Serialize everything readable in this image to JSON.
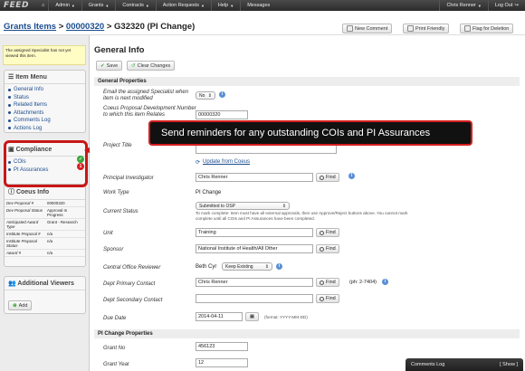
{
  "topnav": {
    "logo": "FEED",
    "items": [
      {
        "label": "Admin"
      },
      {
        "label": "Grants"
      },
      {
        "label": "Contracts"
      },
      {
        "label": "Action Requests"
      },
      {
        "label": "Help"
      },
      {
        "label": "Messages"
      }
    ],
    "user": "Chris Renner",
    "logout": "Log Out"
  },
  "breadcrumb": {
    "root": "Grants Items",
    "sep1": ">",
    "item": "00000320",
    "sep2": ">",
    "current": "G32320 (PI Change)"
  },
  "header_buttons": {
    "new_comment": "New Comment",
    "print_friendly": "Print Friendly",
    "flag_deletion": "Flag for Deletion"
  },
  "notice": "The assigned Specialist has not yet viewed this item.",
  "item_menu": {
    "title": "Item Menu",
    "items": [
      "General Info",
      "Status",
      "Related Items",
      "Attachments",
      "Comments Log",
      "Actions Log"
    ]
  },
  "compliance": {
    "title": "Compliance",
    "items": [
      {
        "label": "COIs",
        "badge": "✓",
        "badge_color": "#3aa53a"
      },
      {
        "label": "PI Assurances",
        "badge": "1",
        "badge_color": "#d61f1f"
      }
    ]
  },
  "coeus_info": {
    "title": "Coeus Info",
    "rows": [
      {
        "k": "Dev Proposal #",
        "v": "00000320"
      },
      {
        "k": "Dev Proposal Status",
        "v": "Approval In Progress"
      },
      {
        "k": "Anticipated Award Type",
        "v": "Grant - Research"
      },
      {
        "k": "Institute Proposal #",
        "v": "n/a"
      },
      {
        "k": "Institute Proposal Status",
        "v": "n/a"
      },
      {
        "k": "Award #",
        "v": "n/a"
      }
    ]
  },
  "additional_viewers": {
    "title": "Additional Viewers",
    "add": "Add"
  },
  "main": {
    "title": "General Info",
    "save": "Save",
    "clear": "Clear Changes",
    "general_properties": "General Properties",
    "pi_change_properties": "PI Change Properties",
    "fields": {
      "email_specialist_label": "Email the assigned Specialist when item is next modified",
      "email_specialist_value": "No",
      "coeus_dev_label": "Coeus Proposal Development Number to which this item Relates",
      "coeus_dev_value": "00000320",
      "project_title_label": "Project Title",
      "update_from_coeus": "Update from Coeus",
      "pi_label": "Principal Investigator",
      "pi_value": "Chris Renner",
      "work_type_label": "Work Type",
      "work_type_value": "PI Change",
      "status_label": "Current Status",
      "status_value": "Submitted to OSP",
      "status_note": "To mark complete: Item must have all external approvals, then use Approve/Reject buttons above. You cannot mark complete until all COIs and PI Assurances have been completed.",
      "unit_label": "Unit",
      "unit_value": "Training",
      "sponsor_label": "Sponsor",
      "sponsor_value": "National Institute of Health/All Other",
      "reviewer_label": "Central Office Reviewer",
      "reviewer_value": "Beth Cyr",
      "reviewer_select": "Keep Existing",
      "dept_primary_label": "Dept Primary Contact",
      "dept_primary_value": "Chris Renner",
      "dept_phone": "(ph: 2-7404)",
      "dept_secondary_label": "Dept Secondary Contact",
      "dept_secondary_value": "",
      "due_date_label": "Due Date",
      "due_date_value": "2014-04-11",
      "due_date_format": "(format: YYYY-MM-DD)",
      "grant_no_label": "Grant No",
      "grant_no_value": "456123",
      "grant_year_label": "Grant Year",
      "grant_year_value": "12",
      "find": "Find"
    }
  },
  "callout": "Send reminders for any outstanding COIs and PI Assurances",
  "comments_log": {
    "title": "Comments Log",
    "show": "[ Show ]"
  }
}
